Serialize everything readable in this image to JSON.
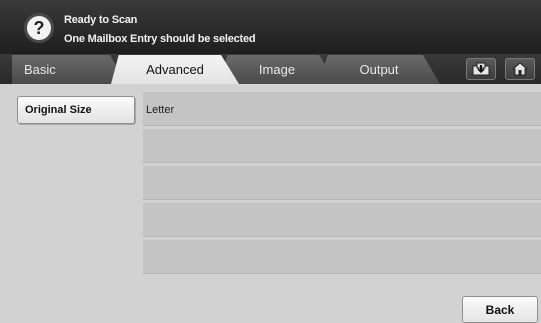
{
  "status": {
    "title": "Ready to Scan",
    "message": "One Mailbox Entry should be selected",
    "help_icon": "question-mark-icon",
    "help_glyph": "?"
  },
  "tabs": [
    {
      "label": "Basic",
      "active": false
    },
    {
      "label": "Advanced",
      "active": true
    },
    {
      "label": "Image",
      "active": false
    },
    {
      "label": "Output",
      "active": false
    }
  ],
  "toolbar": {
    "job_status_icon": "job-status-icon",
    "home_icon": "home-icon"
  },
  "settings": {
    "option_label": "Original Size",
    "rows": [
      {
        "value": "Letter"
      },
      {
        "value": ""
      },
      {
        "value": ""
      },
      {
        "value": ""
      },
      {
        "value": ""
      }
    ]
  },
  "footer": {
    "back_label": "Back"
  }
}
